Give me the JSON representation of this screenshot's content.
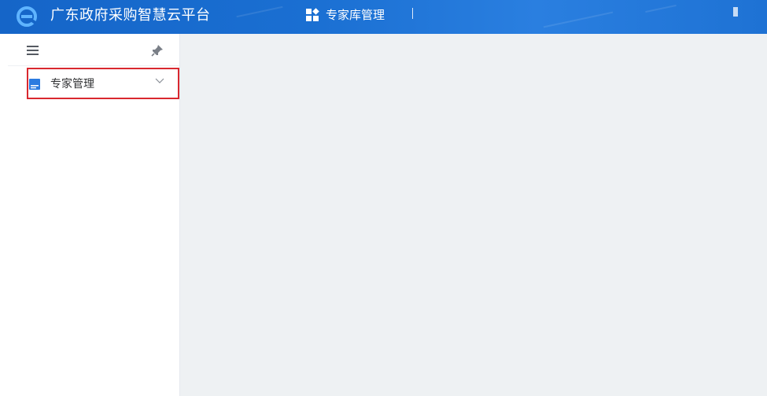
{
  "header": {
    "app_title": "广东政府采购智慧云平台",
    "module_label": "专家库管理",
    "logo_icon": "e-logo-icon",
    "module_icon": "grid-apps-icon",
    "bg_color": "#1a6fd2"
  },
  "sidebar": {
    "toolbar": {
      "menu_toggle_icon": "hamburger-icon",
      "pin_icon": "pin-icon"
    },
    "items": [
      {
        "label": "专家管理",
        "icon": "expert-card-icon",
        "expand_icon": "chevron-down-icon",
        "highlighted": true,
        "highlight_color": "#d9282f"
      }
    ]
  },
  "main": {
    "bg_color": "#eef1f3"
  }
}
